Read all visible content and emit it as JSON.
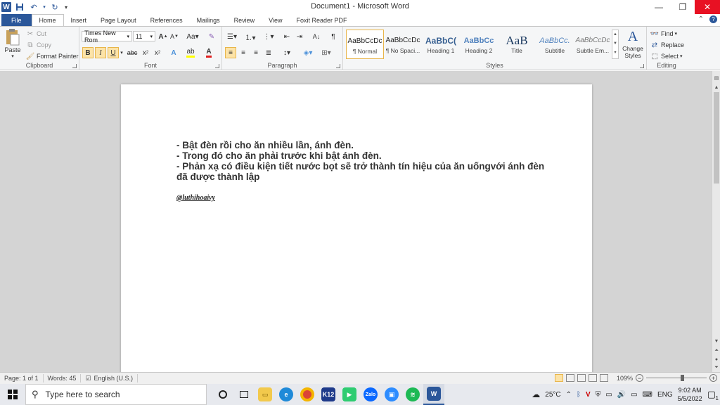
{
  "window": {
    "title": "Document1 - Microsoft Word"
  },
  "colors": {
    "accent": "#2b579a",
    "close": "#e81123",
    "highlight": "#fce3a8"
  },
  "tabs": [
    {
      "label": "File"
    },
    {
      "label": "Home"
    },
    {
      "label": "Insert"
    },
    {
      "label": "Page Layout"
    },
    {
      "label": "References"
    },
    {
      "label": "Mailings"
    },
    {
      "label": "Review"
    },
    {
      "label": "View"
    },
    {
      "label": "Foxit Reader PDF"
    }
  ],
  "clipboard": {
    "label": "Clipboard",
    "paste": "Paste",
    "cut": "Cut",
    "copy": "Copy",
    "format_painter": "Format Painter"
  },
  "font": {
    "label": "Font",
    "family": "Times New Rom",
    "size": "11"
  },
  "paragraph": {
    "label": "Paragraph"
  },
  "styles": {
    "label": "Styles",
    "items": [
      {
        "sample": "AaBbCcDc",
        "name": "¶ Normal"
      },
      {
        "sample": "AaBbCcDc",
        "name": "¶ No Spaci..."
      },
      {
        "sample": "AaBbC(",
        "name": "Heading 1"
      },
      {
        "sample": "AaBbCc",
        "name": "Heading 2"
      },
      {
        "sample": "AaB",
        "name": "Title"
      },
      {
        "sample": "AaBbCc.",
        "name": "Subtitle"
      },
      {
        "sample": "AaBbCcDc",
        "name": "Subtle Em..."
      }
    ],
    "change_styles": "Change Styles"
  },
  "editing": {
    "label": "Editing",
    "find": "Find",
    "replace": "Replace",
    "select": "Select"
  },
  "document": {
    "lines": [
      "- Bật đèn rồi cho ăn nhiều lần, ánh đèn.",
      "- Trong đó cho ăn phải trước khi bật ánh đèn.",
      "- Phản xạ có điều kiện tiết nước bọt sẽ trở thành tín hiệu của ăn uốngvới ánh đèn",
      "đã được thành lập"
    ],
    "signature": "@luthihoaivy"
  },
  "statusbar": {
    "page": "Page: 1 of 1",
    "words": "Words: 45",
    "language": "English (U.S.)",
    "zoom": "109%",
    "zoom_level": 0.6
  },
  "taskbar": {
    "search_placeholder": "Type here to search",
    "temperature": "25°C",
    "language": "ENG",
    "time": "9:02 AM",
    "date": "5/5/2022",
    "notifications": "1"
  }
}
